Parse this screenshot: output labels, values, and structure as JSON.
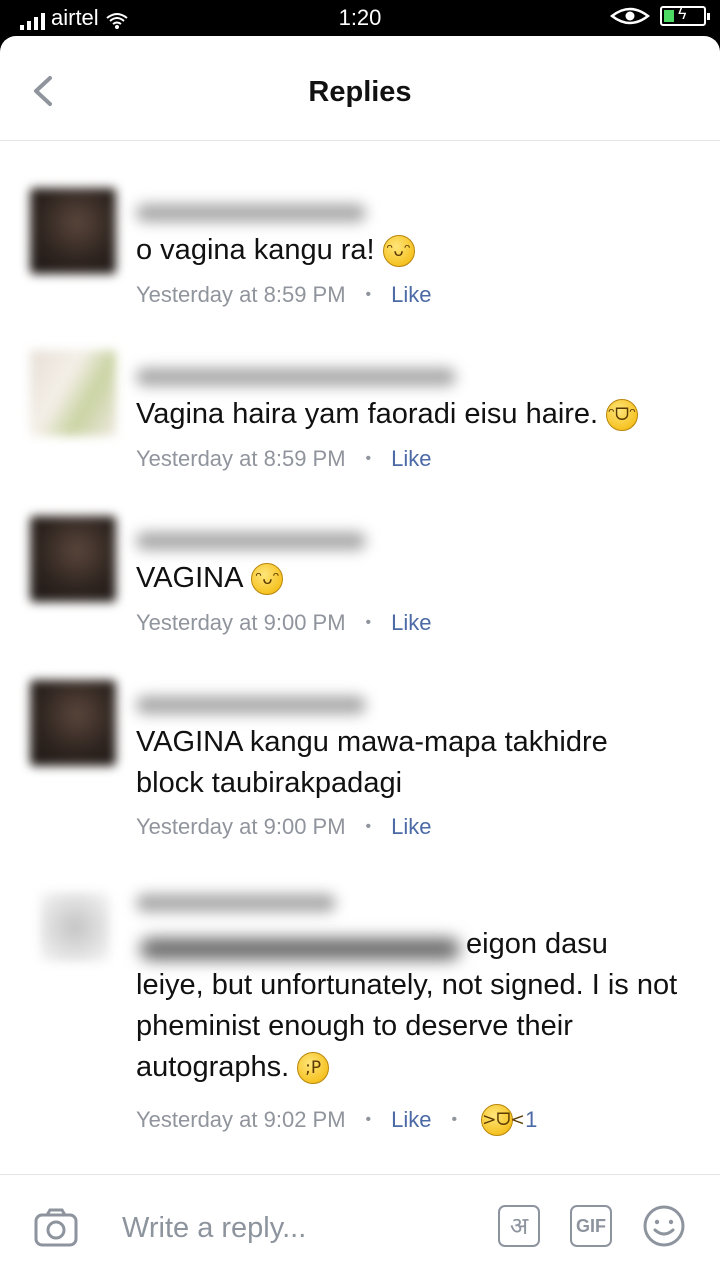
{
  "status_bar": {
    "carrier": "airtel",
    "time": "1:20"
  },
  "header": {
    "title": "Replies"
  },
  "comments": [
    {
      "text": "o vagina kangu ra!",
      "emoji": "grinning-emoji",
      "time": "Yesterday at 8:59 PM",
      "like": "Like"
    },
    {
      "text": "Vagina haira yam faoradi eisu haire.",
      "emoji": "tears-of-joy-emoji",
      "time": "Yesterday at 8:59 PM",
      "like": "Like"
    },
    {
      "text": "VAGINA",
      "emoji": "grinning-emoji",
      "time": "Yesterday at 9:00 PM",
      "like": "Like"
    },
    {
      "text": "VAGINA kangu mawa-mapa takhidre block taubirakpadagi",
      "time": "Yesterday at 9:00 PM",
      "like": "Like"
    },
    {
      "text_first": "eigon dasu",
      "text_rest": "leiye, but unfortunately, not signed. I is not pheminist enough to deserve their autographs.",
      "emoji": "winking-tongue-emoji",
      "time": "Yesterday at 9:02 PM",
      "like": "Like",
      "reaction": {
        "icon": "laughing-emoji",
        "count": "1"
      }
    }
  ],
  "composer": {
    "placeholder": "Write a reply...",
    "hindi_label": "अ",
    "gif_label": "GIF"
  }
}
